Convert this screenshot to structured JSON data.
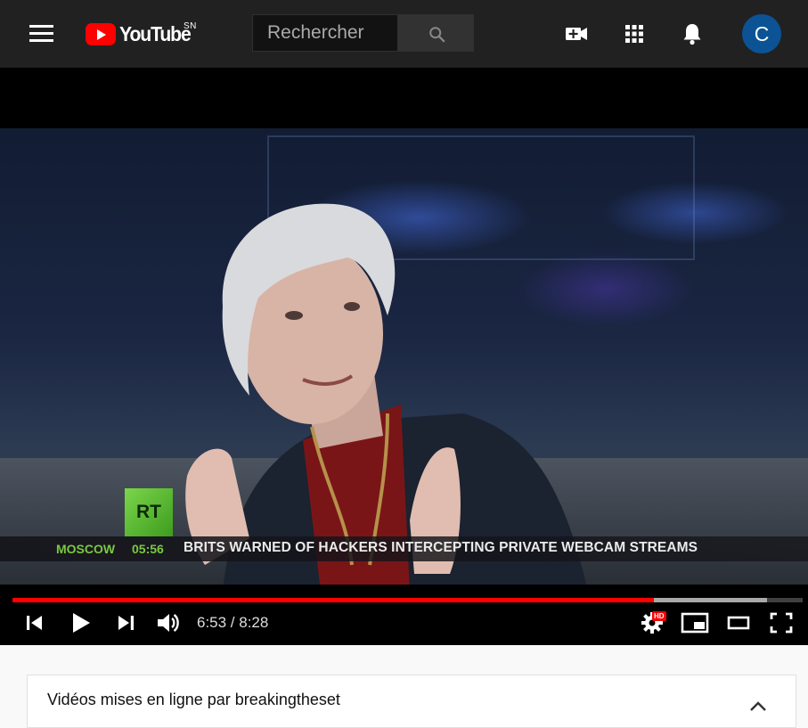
{
  "header": {
    "logo_text": "YouTube",
    "country_code": "SN",
    "search_placeholder": "Rechercher",
    "avatar_letter": "C",
    "icons": [
      "menu-icon",
      "search-icon",
      "create-video-icon",
      "apps-grid-icon",
      "notifications-bell-icon"
    ]
  },
  "video": {
    "channel_logo": "RT",
    "ticker_city": "MOSCOW",
    "ticker_time": "05:56",
    "ticker_headline": "BRITS WARNED OF HACKERS INTERCEPTING PRIVATE WEBCAM STREAMS"
  },
  "player": {
    "current_time": "6:53",
    "duration": "8:28",
    "time_display": "6:53 / 8:28",
    "played_fraction": 0.812,
    "buffered_fraction": 0.955,
    "quality_badge": "HD",
    "colors": {
      "played": "#ff0000",
      "accent": "#ff0000"
    },
    "controls": [
      "previous-icon",
      "play-icon",
      "next-icon",
      "volume-icon",
      "settings-icon",
      "miniplayer-icon",
      "theater-mode-icon",
      "fullscreen-icon"
    ]
  },
  "playlist": {
    "title": "Vidéos mises en ligne par breakingtheset"
  }
}
